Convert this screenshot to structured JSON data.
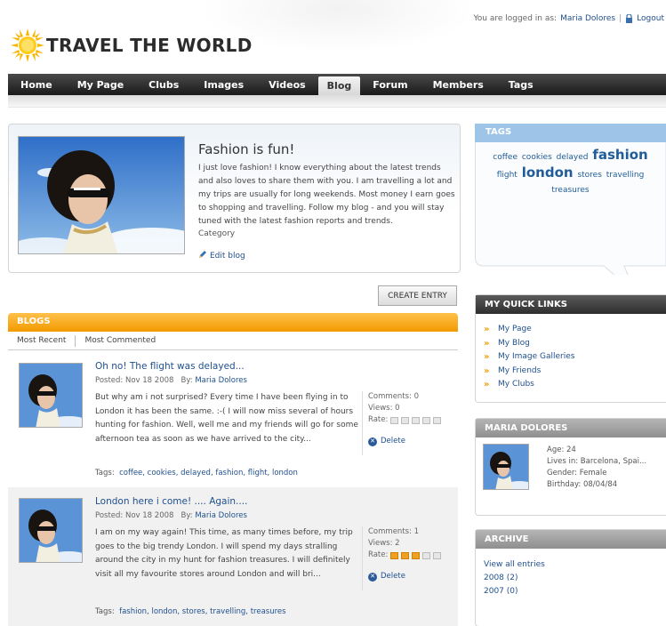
{
  "header": {
    "logo_text": "TRAVEL THE WORLD",
    "logged_in_label": "You are logged in as:",
    "user_name": "Maria Dolores",
    "logout_label": "Logout"
  },
  "nav": {
    "items": [
      {
        "label": "Home",
        "active": false
      },
      {
        "label": "My Page",
        "active": false
      },
      {
        "label": "Clubs",
        "active": false
      },
      {
        "label": "Images",
        "active": false
      },
      {
        "label": "Videos",
        "active": false
      },
      {
        "label": "Blog",
        "active": true
      },
      {
        "label": "Forum",
        "active": false
      },
      {
        "label": "Members",
        "active": false
      },
      {
        "label": "Tags",
        "active": false
      }
    ]
  },
  "profile": {
    "title": "Fashion is fun!",
    "text": "I just love fashion! I know everything about the latest trends and also loves to share them with you. I am travelling a lot and my trips are usually for long weekends. Most money I earn goes to shopping and travelling. Follow my blog - and you will stay tuned with the latest fashion reports and trends.",
    "category_label": "Category",
    "edit_label": "Edit blog"
  },
  "create_entry_label": "CREATE ENTRY",
  "blogs": {
    "heading": "BLOGS",
    "tabs": [
      "Most Recent",
      "Most Commented"
    ],
    "entries": [
      {
        "title": "Oh no! The flight was delayed...",
        "posted": "Posted: Nov 18 2008",
        "by_label": "By:",
        "author": "Maria Dolores",
        "body": "But why am i not surprised? Every time I have been flying in to London it has been the same. :-( I will now miss several of hours hunting for fashion. Well, well me and my friends will go for some afternoon tea as soon as we have arrived to the city...",
        "comments": "Comments: 0",
        "views": "Views: 0",
        "rate_label": "Rate:",
        "rating": 0,
        "delete_label": "Delete",
        "tags_label": "Tags:",
        "tags": "coffee, cookies, delayed, fashion, flight, london"
      },
      {
        "title": "London here i come! .... Again....",
        "posted": "Posted: Nov 18 2008",
        "by_label": "By:",
        "author": "Maria Dolores",
        "body": "I am on my way again! This time, as many times before, my trip goes to the big trendy London. I will spend my days stralling around the city in my hunt for fashion treasures. I will definitely visit all my favourite stores around London and will bri...",
        "comments": "Comments: 1",
        "views": "Views: 2",
        "rate_label": "Rate:",
        "rating": 3,
        "delete_label": "Delete",
        "tags_label": "Tags:",
        "tags": "fashion, london, stores, travelling, treasures"
      }
    ]
  },
  "tags_box": {
    "heading": "TAGS",
    "cloud": [
      {
        "text": "coffee",
        "size": "small"
      },
      {
        "text": "cookies",
        "size": "small"
      },
      {
        "text": "delayed",
        "size": "small"
      },
      {
        "text": "fashion",
        "size": "large"
      },
      {
        "text": "flight",
        "size": "small"
      },
      {
        "text": "london",
        "size": "large"
      },
      {
        "text": "stores",
        "size": "small"
      },
      {
        "text": "travelling",
        "size": "small"
      },
      {
        "text": "treasures",
        "size": "small"
      }
    ]
  },
  "quick_links": {
    "heading": "MY QUICK LINKS",
    "items": [
      "My Page",
      "My Blog",
      "My Image Galleries",
      "My Friends",
      "My Clubs"
    ]
  },
  "maria": {
    "heading": "MARIA DOLORES",
    "age": "Age: 24",
    "lives": "Lives in: Barcelona, Spai...",
    "gender": "Gender: Female",
    "birthday": "Birthday: 08/04/84"
  },
  "archive": {
    "heading": "ARCHIVE",
    "items": [
      "View all entries",
      "2008 (2)",
      "2007 (0)"
    ]
  },
  "colors": {
    "accent_orange": "#f29a00",
    "nav_dark": "#1a1a1a",
    "link_blue": "#1f4f8f",
    "tags_blue": "#9ec5e8"
  }
}
